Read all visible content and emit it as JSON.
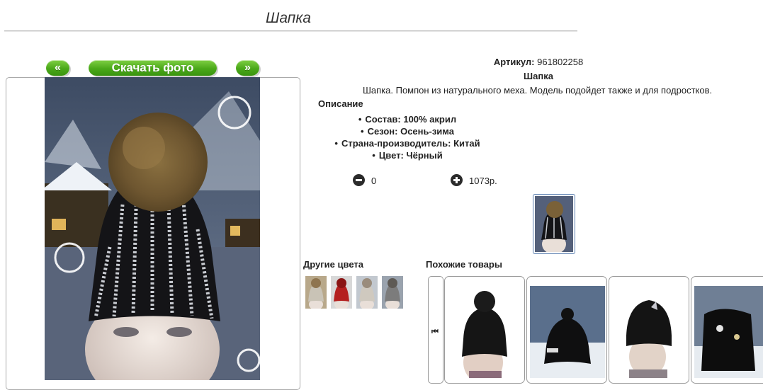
{
  "page": {
    "title": "Шапка"
  },
  "photo_nav": {
    "prev_label": "«",
    "download_label": "Скачать фото",
    "next_label": "»"
  },
  "product": {
    "article_label": "Артикул:",
    "article_value": "961802258",
    "name": "Шапка",
    "short_description": "Шапка. Помпон из натурального меха. Модель подойдет также и для подростков.",
    "description_heading": "Описание",
    "attributes": [
      "Состав: 100% акрил",
      "Сезон: Осень-зима",
      "Страна-производитель: Китай",
      "Цвет: Чёрный"
    ],
    "quantity": "0",
    "price": "1073р."
  },
  "other_colors": {
    "heading": "Другие цвета",
    "items": [
      {
        "color": "#b8a88a",
        "hat": "#c9c3b6",
        "pom": "#8f7550"
      },
      {
        "color": "#c22a2a",
        "hat": "#b42020",
        "pom": "#8a1515"
      },
      {
        "color": "#d8d2c8",
        "hat": "#cfc9bf",
        "pom": "#9a8c7c"
      },
      {
        "color": "#8a8a8a",
        "hat": "#7c7c7c",
        "pom": "#5e5a55"
      }
    ]
  },
  "similar": {
    "heading": "Похожие товары",
    "nav_icon": "skip-back-icon",
    "nav_glyph": "⏮"
  },
  "colors": {
    "accent_green": "#4aa819",
    "thumb_border": "#5b7fb0"
  }
}
